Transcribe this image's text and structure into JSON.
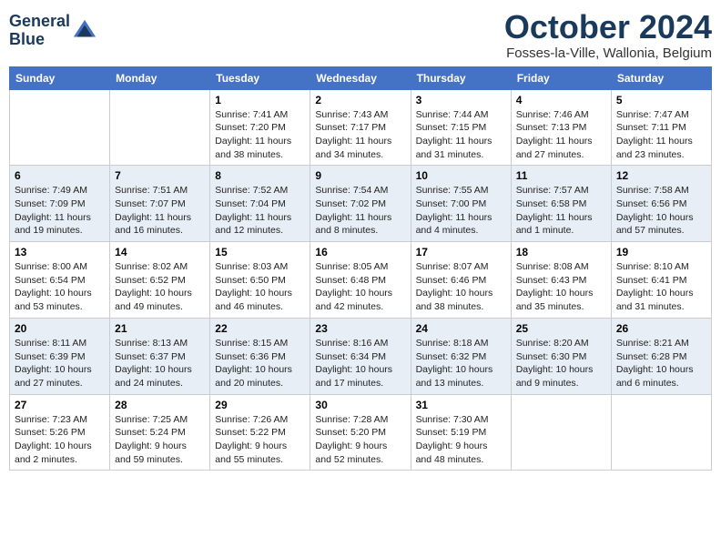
{
  "logo": {
    "line1": "General",
    "line2": "Blue"
  },
  "title": "October 2024",
  "location": "Fosses-la-Ville, Wallonia, Belgium",
  "days_of_week": [
    "Sunday",
    "Monday",
    "Tuesday",
    "Wednesday",
    "Thursday",
    "Friday",
    "Saturday"
  ],
  "weeks": [
    [
      {
        "num": "",
        "info": ""
      },
      {
        "num": "",
        "info": ""
      },
      {
        "num": "1",
        "info": "Sunrise: 7:41 AM\nSunset: 7:20 PM\nDaylight: 11 hours and 38 minutes."
      },
      {
        "num": "2",
        "info": "Sunrise: 7:43 AM\nSunset: 7:17 PM\nDaylight: 11 hours and 34 minutes."
      },
      {
        "num": "3",
        "info": "Sunrise: 7:44 AM\nSunset: 7:15 PM\nDaylight: 11 hours and 31 minutes."
      },
      {
        "num": "4",
        "info": "Sunrise: 7:46 AM\nSunset: 7:13 PM\nDaylight: 11 hours and 27 minutes."
      },
      {
        "num": "5",
        "info": "Sunrise: 7:47 AM\nSunset: 7:11 PM\nDaylight: 11 hours and 23 minutes."
      }
    ],
    [
      {
        "num": "6",
        "info": "Sunrise: 7:49 AM\nSunset: 7:09 PM\nDaylight: 11 hours and 19 minutes."
      },
      {
        "num": "7",
        "info": "Sunrise: 7:51 AM\nSunset: 7:07 PM\nDaylight: 11 hours and 16 minutes."
      },
      {
        "num": "8",
        "info": "Sunrise: 7:52 AM\nSunset: 7:04 PM\nDaylight: 11 hours and 12 minutes."
      },
      {
        "num": "9",
        "info": "Sunrise: 7:54 AM\nSunset: 7:02 PM\nDaylight: 11 hours and 8 minutes."
      },
      {
        "num": "10",
        "info": "Sunrise: 7:55 AM\nSunset: 7:00 PM\nDaylight: 11 hours and 4 minutes."
      },
      {
        "num": "11",
        "info": "Sunrise: 7:57 AM\nSunset: 6:58 PM\nDaylight: 11 hours and 1 minute."
      },
      {
        "num": "12",
        "info": "Sunrise: 7:58 AM\nSunset: 6:56 PM\nDaylight: 10 hours and 57 minutes."
      }
    ],
    [
      {
        "num": "13",
        "info": "Sunrise: 8:00 AM\nSunset: 6:54 PM\nDaylight: 10 hours and 53 minutes."
      },
      {
        "num": "14",
        "info": "Sunrise: 8:02 AM\nSunset: 6:52 PM\nDaylight: 10 hours and 49 minutes."
      },
      {
        "num": "15",
        "info": "Sunrise: 8:03 AM\nSunset: 6:50 PM\nDaylight: 10 hours and 46 minutes."
      },
      {
        "num": "16",
        "info": "Sunrise: 8:05 AM\nSunset: 6:48 PM\nDaylight: 10 hours and 42 minutes."
      },
      {
        "num": "17",
        "info": "Sunrise: 8:07 AM\nSunset: 6:46 PM\nDaylight: 10 hours and 38 minutes."
      },
      {
        "num": "18",
        "info": "Sunrise: 8:08 AM\nSunset: 6:43 PM\nDaylight: 10 hours and 35 minutes."
      },
      {
        "num": "19",
        "info": "Sunrise: 8:10 AM\nSunset: 6:41 PM\nDaylight: 10 hours and 31 minutes."
      }
    ],
    [
      {
        "num": "20",
        "info": "Sunrise: 8:11 AM\nSunset: 6:39 PM\nDaylight: 10 hours and 27 minutes."
      },
      {
        "num": "21",
        "info": "Sunrise: 8:13 AM\nSunset: 6:37 PM\nDaylight: 10 hours and 24 minutes."
      },
      {
        "num": "22",
        "info": "Sunrise: 8:15 AM\nSunset: 6:36 PM\nDaylight: 10 hours and 20 minutes."
      },
      {
        "num": "23",
        "info": "Sunrise: 8:16 AM\nSunset: 6:34 PM\nDaylight: 10 hours and 17 minutes."
      },
      {
        "num": "24",
        "info": "Sunrise: 8:18 AM\nSunset: 6:32 PM\nDaylight: 10 hours and 13 minutes."
      },
      {
        "num": "25",
        "info": "Sunrise: 8:20 AM\nSunset: 6:30 PM\nDaylight: 10 hours and 9 minutes."
      },
      {
        "num": "26",
        "info": "Sunrise: 8:21 AM\nSunset: 6:28 PM\nDaylight: 10 hours and 6 minutes."
      }
    ],
    [
      {
        "num": "27",
        "info": "Sunrise: 7:23 AM\nSunset: 5:26 PM\nDaylight: 10 hours and 2 minutes."
      },
      {
        "num": "28",
        "info": "Sunrise: 7:25 AM\nSunset: 5:24 PM\nDaylight: 9 hours and 59 minutes."
      },
      {
        "num": "29",
        "info": "Sunrise: 7:26 AM\nSunset: 5:22 PM\nDaylight: 9 hours and 55 minutes."
      },
      {
        "num": "30",
        "info": "Sunrise: 7:28 AM\nSunset: 5:20 PM\nDaylight: 9 hours and 52 minutes."
      },
      {
        "num": "31",
        "info": "Sunrise: 7:30 AM\nSunset: 5:19 PM\nDaylight: 9 hours and 48 minutes."
      },
      {
        "num": "",
        "info": ""
      },
      {
        "num": "",
        "info": ""
      }
    ]
  ]
}
